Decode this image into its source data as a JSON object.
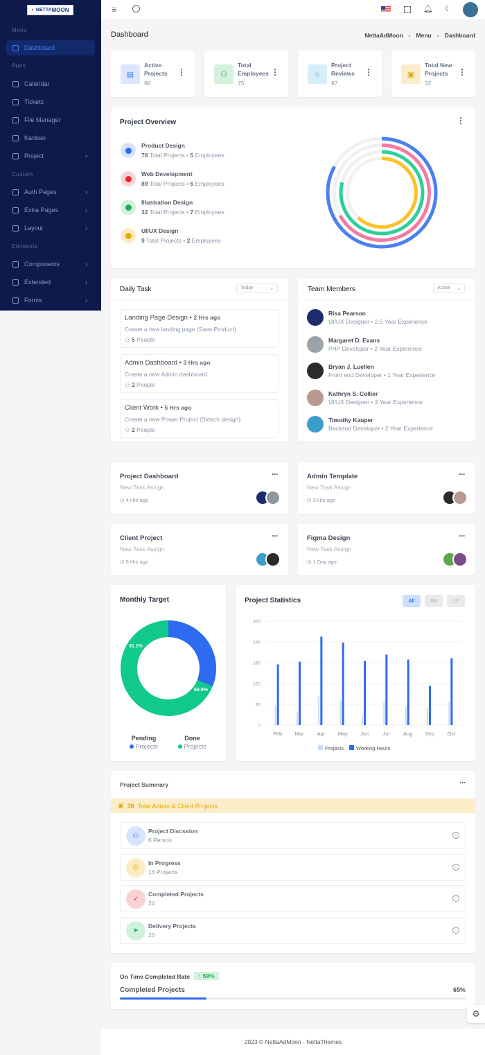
{
  "logo": {
    "text": "NETTA MOON"
  },
  "sidebar": {
    "sections": [
      "Menu",
      "Apps",
      "Custom",
      "Elements"
    ],
    "items": [
      {
        "label": "Dashboard",
        "active": true
      },
      {
        "label": "Calendar"
      },
      {
        "label": "Tickets"
      },
      {
        "label": "File Manager"
      },
      {
        "label": "Kanban"
      },
      {
        "label": "Project",
        "chevron": true
      },
      {
        "label": "Auth Pages",
        "chevron": true
      },
      {
        "label": "Extra Pages",
        "chevron": true
      },
      {
        "label": "Layout",
        "chevron": true
      },
      {
        "label": "Components",
        "chevron": true
      },
      {
        "label": "Extended",
        "chevron": true
      },
      {
        "label": "Forms",
        "chevron": true
      }
    ]
  },
  "page": {
    "title": "Dashboard",
    "breadcrumb": [
      "NettaAdMoon",
      "Menu",
      "Dashboard"
    ]
  },
  "stats": [
    {
      "label": "Active Projects",
      "value": "98",
      "color": "#dbe6ff",
      "icon": "file-icon",
      "iconColor": "#3b82f6"
    },
    {
      "label": "Total Employees",
      "value": "75",
      "color": "#d4f1dc",
      "icon": "users-icon",
      "iconColor": "#22a55a"
    },
    {
      "label": "Project Reviews",
      "value": "97",
      "color": "#d6eefa",
      "icon": "star-icon",
      "iconColor": "#1ea0d8"
    },
    {
      "label": "Total New Projects",
      "value": "32",
      "color": "#fbeccb",
      "icon": "folder-icon",
      "iconColor": "#e4a70b"
    }
  ],
  "overview": {
    "title": "Project Overview",
    "items": [
      {
        "name": "Product Design",
        "projects": "78",
        "employees": "5",
        "color": "#2f6bf0",
        "bg": "#d8e3fd",
        "ring_percent": 83
      },
      {
        "name": "Web Development",
        "projects": "89",
        "employees": "6",
        "color": "#e5262d",
        "bg": "#f9d3d4",
        "ring_percent": 67
      },
      {
        "name": "Illustration Design",
        "projects": "32",
        "employees": "7",
        "color": "#1fae54",
        "bg": "#d1f1dc",
        "ring_percent": 79
      },
      {
        "name": "UI/UX Design",
        "projects": "9",
        "employees": "2",
        "color": "#e5a90a",
        "bg": "#fbecc4",
        "ring_percent": 62
      }
    ],
    "total_label": "Total Projects",
    "emp_label": "Employees",
    "ring_colors": [
      "#4a80f0",
      "#f47ca3",
      "#2ecf98",
      "#fcc22c"
    ]
  },
  "daily": {
    "title": "Daily Task",
    "filter": "Today",
    "tasks": [
      {
        "title": "Landing Page Design",
        "time": "2 Hrs ago",
        "desc": "Create a new landing page (Saas Product)",
        "people": "5",
        "people_label": "People"
      },
      {
        "title": "Admin Dashboard",
        "time": "3 Hrs ago",
        "desc": "Create a new Admin dashboard",
        "people": "2",
        "people_label": "People"
      },
      {
        "title": "Client Work",
        "time": "5 Hrs ago",
        "desc": "Create a new Power Project (Sktech design)",
        "people": "2",
        "people_label": "People"
      }
    ]
  },
  "team": {
    "title": "Team Members",
    "filter": "Active",
    "members": [
      {
        "name": "Risa Pearson",
        "role": "UI/UX Designer",
        "exp": "2.5 Year Experience",
        "avatar": "#1d2d6b"
      },
      {
        "name": "Margaret D. Evans",
        "role": "PHP Developer",
        "exp": "2 Year Experience",
        "avatar": "#9aa3a8"
      },
      {
        "name": "Bryan J. Luellen",
        "role": "Front end Developer",
        "exp": "1 Year Experience",
        "avatar": "#2a2a2a"
      },
      {
        "name": "Kathryn S. Collier",
        "role": "UI/UX Designer",
        "exp": "3 Year Experience",
        "avatar": "#b89a92"
      },
      {
        "name": "Timothy Kauper",
        "role": "Backend Developer",
        "exp": "2 Year Experience",
        "avatar": "#3b9ec9"
      }
    ]
  },
  "tasks": [
    {
      "title": "Project Dashboard",
      "sub": "New Task Assign",
      "time": "4 Hrs ago",
      "avatars": [
        "#1d2d6b",
        "#8d979c"
      ]
    },
    {
      "title": "Admin Template",
      "sub": "New Task Assign",
      "time": "3 Hrs ago",
      "avatars": [
        "#2a2a2a",
        "#b89a92"
      ]
    },
    {
      "title": "Client Project",
      "sub": "New Task Assign",
      "time": "5 Hrs ago",
      "avatars": [
        "#3b9ec9",
        "#2a2a2a"
      ]
    },
    {
      "title": "Figma Design",
      "sub": "New Task Assign",
      "time": "1 Day ago",
      "avatars": [
        "#5aa84a",
        "#7a4a8a"
      ]
    }
  ],
  "monthly": {
    "title": "Monthly Target",
    "pending_pct": 31.1,
    "done_pct": 68.9,
    "pending_label": "31.1%",
    "done_label": "68.9%",
    "legend": [
      {
        "title": "Pending",
        "label": "Projects",
        "color": "#2f6bf0"
      },
      {
        "title": "Done",
        "label": "Projects",
        "color": "#10c98a"
      }
    ]
  },
  "chart_data": {
    "type": "bar",
    "title": "Project Statistics",
    "buttons": [
      "All",
      "6M",
      "1Y"
    ],
    "active_button": "All",
    "categories": [
      "Feb",
      "Mar",
      "Apr",
      "May",
      "Jun",
      "Jul",
      "Aug",
      "Sep",
      "Oct"
    ],
    "series": [
      {
        "name": "Projects",
        "color": "#c9dafc",
        "values": [
          55,
          37,
          83,
          70,
          28,
          68,
          53,
          50,
          68
        ]
      },
      {
        "name": "Working Hours",
        "color": "#2f6bf0",
        "values": [
          175,
          183,
          255,
          238,
          185,
          203,
          189,
          113,
          193
        ]
      }
    ],
    "ylim": [
      0,
      300
    ],
    "yticks": [
      "0",
      "60",
      "120",
      "180",
      "240",
      "300"
    ],
    "grid": true,
    "legend": "bottom"
  },
  "summary": {
    "title": "Project Summary",
    "banner_count": "38",
    "banner_text": "Total Admin & Client Projects",
    "rows": [
      {
        "title": "Project Discssion",
        "sub": "6 Person",
        "bg": "#d8e3fd",
        "color": "#2f6bf0",
        "icon": "users-icon"
      },
      {
        "title": "In Progress",
        "sub": "16 Projects",
        "bg": "#fbecc4",
        "color": "#e5a90a",
        "icon": "progress-icon"
      },
      {
        "title": "Completed Projects",
        "sub": "24",
        "bg": "#f9d3d4",
        "color": "#e5262d",
        "icon": "check-circle-icon"
      },
      {
        "title": "Delivery Projects",
        "sub": "20",
        "bg": "#d1f1dc",
        "color": "#1fae54",
        "icon": "send-icon"
      }
    ]
  },
  "rate": {
    "title": "On Time Completed Rate",
    "badge": "↑ 59%",
    "label": "Completed Projects",
    "value": "65%",
    "fill_percent": 25
  },
  "footer": {
    "text": "2023 © NettaAdMoon - NettaThemes"
  }
}
